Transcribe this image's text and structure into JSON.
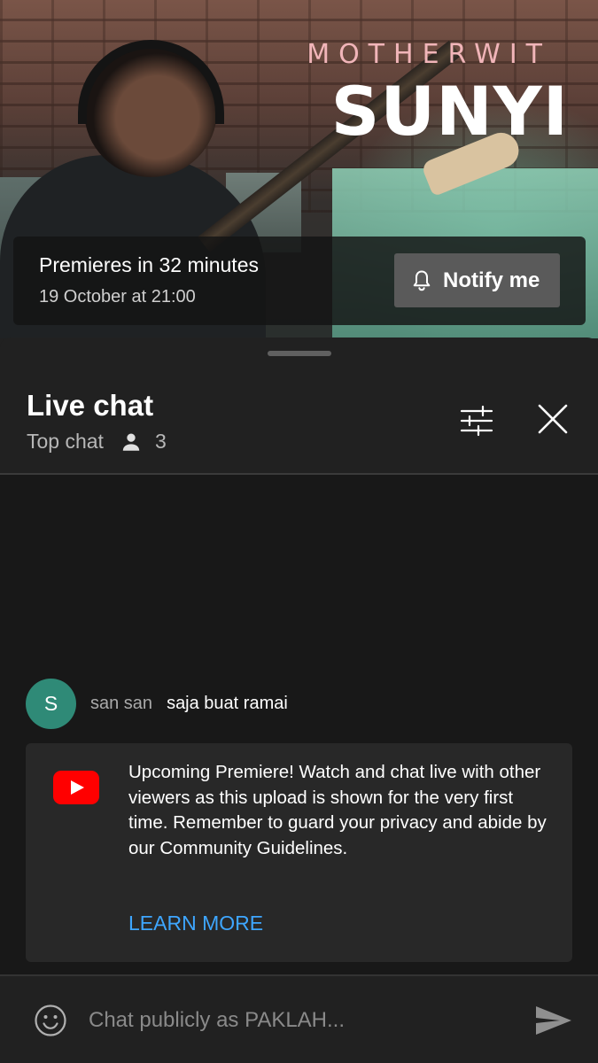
{
  "video": {
    "band_name": "MOTHERWIT",
    "song_title": "SUNYI",
    "premiere_title": "Premieres in 32 minutes",
    "premiere_date": "19 October at 21:00",
    "notify_label": "Notify me"
  },
  "chat": {
    "title": "Live chat",
    "mode": "Top chat",
    "viewer_count": "3"
  },
  "messages": [
    {
      "avatar_letter": "S",
      "author": "san san",
      "text": "saja buat ramai",
      "avatar_color": "#2f8a77"
    }
  ],
  "notice": {
    "text": "Upcoming Premiere! Watch and chat live with other viewers as this upload is shown for the very first time. Remember to guard your privacy and abide by our Community Guidelines.",
    "link_label": "LEARN MORE"
  },
  "input": {
    "placeholder": "Chat publicly as PAKLAH..."
  },
  "colors": {
    "accent_link": "#3ea6ff",
    "avatar": "#2f8a77",
    "youtube_red": "#ff0000"
  },
  "icons": [
    "bell-icon",
    "person-icon",
    "filter-icon",
    "close-icon",
    "youtube-icon",
    "emoji-icon",
    "send-icon"
  ]
}
